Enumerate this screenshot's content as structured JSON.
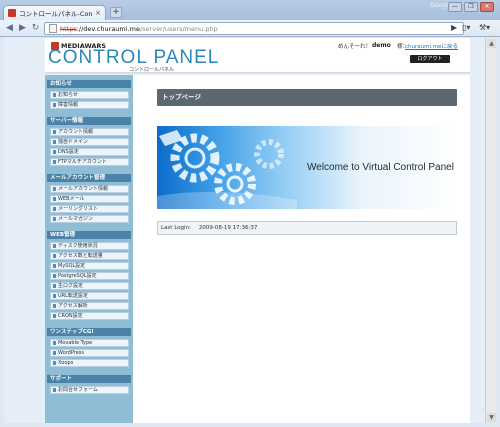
{
  "browser": {
    "tab_title": "コントロールパネル-Control ...",
    "tab_close": "×",
    "new_tab": "+",
    "brand": "Google",
    "window_controls": [
      "—",
      "❐",
      "✕"
    ],
    "nav": {
      "back": "◀",
      "forward": "▶",
      "reload": "↻"
    },
    "url": {
      "scheme": "https",
      "host": "://dev.churaumi.me",
      "path": "/server/users/menu.php"
    },
    "toolbar_icons": {
      "go": "▶",
      "page": "▯▾",
      "wrench": "⚒▾"
    }
  },
  "header": {
    "logo": "MEDIAWARS",
    "title": "CONTROL PANEL",
    "subtitle": "コントロールパネル",
    "welcome_prefix": "めんそーれ！",
    "user": "demo",
    "host_label": "様：",
    "host_link": "churaumi.meに戻る",
    "logout": "ログアウト"
  },
  "sidebar": {
    "sections": [
      {
        "title": "お知らせ",
        "items": [
          "お知らせ",
          "障害情報"
        ]
      },
      {
        "title": "サーバー情報",
        "items": [
          "アカウント情報",
          "独自ドメイン",
          "DNS設定",
          "FTPマルチアカウント"
        ]
      },
      {
        "title": "メールアカウント管理",
        "items": [
          "メールアカウント情報",
          "WEBメール",
          "メーリングリスト",
          "メールマガジン"
        ]
      },
      {
        "title": "WEB管理",
        "items": [
          "ディスク使用状況",
          "アクセス数と転送量",
          "MySQL設定",
          "PostgreSQL設定",
          "生ログ設定",
          "URL転送設定",
          "アクセス解析",
          "CRON設定"
        ]
      },
      {
        "title": "ワンステップCGI",
        "items": [
          "Movable Type",
          "WordPress",
          "Xoops"
        ]
      },
      {
        "title": "サポート",
        "items": [
          "お問合せフォーム"
        ]
      }
    ]
  },
  "main": {
    "heading": "トップページ",
    "banner_text": "Welcome to Virtual Control Panel",
    "last_login_label": "Last Login:",
    "last_login_value": "2009-08-19 17:36:37"
  },
  "colors": {
    "accent": "#2c86b8",
    "sidebar_bg": "#8fbdd6",
    "section_head": "#4a82a8",
    "heading_bar": "#5c6870"
  }
}
